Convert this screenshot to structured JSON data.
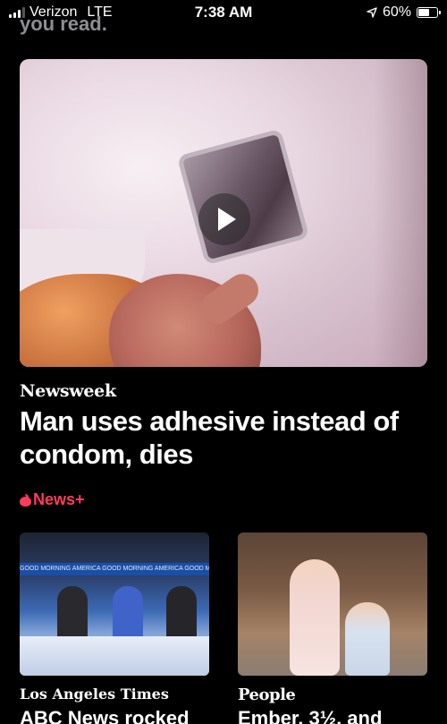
{
  "status_bar": {
    "carrier": "Verizon",
    "network": "LTE",
    "time": "7:38 AM",
    "battery": "60%",
    "battery_fraction": 0.6
  },
  "previous_item_tail": "you read.",
  "feature": {
    "source": "Newsweek",
    "headline": "Man uses adhesive instead of condom, dies",
    "has_video": true
  },
  "news_plus_label": "News+",
  "cards": [
    {
      "source": "Los Angeles Times",
      "headline": "ABC News rocked",
      "banner_text": "GOOD MORNING AMERICA  GOOD MORNING AMERICA  GOOD MORNING AMERICA"
    },
    {
      "source": "People",
      "headline": "Ember, 3½, and"
    }
  ],
  "colors": {
    "background": "#000000",
    "news_plus": "#ff3b5c"
  }
}
